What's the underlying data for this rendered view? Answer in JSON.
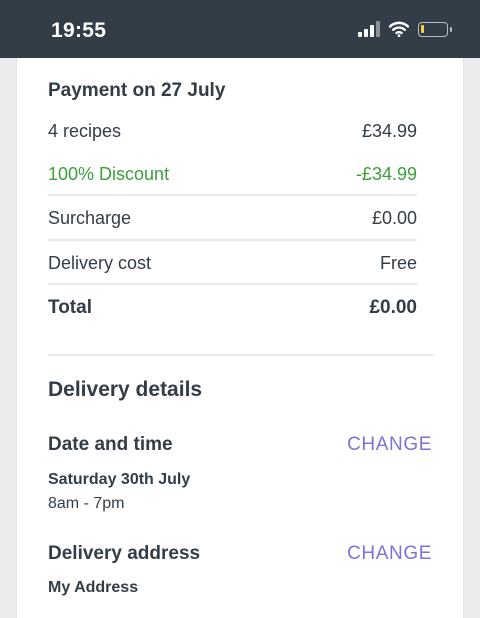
{
  "status_bar": {
    "time": "19:55",
    "icons": [
      "signal-icon",
      "wifi-icon",
      "battery-icon"
    ],
    "battery_fill_fraction": 0.12
  },
  "payment": {
    "title": "Payment on 27 July",
    "rows": [
      {
        "label": "4 recipes",
        "value": "£34.99"
      },
      {
        "label": "100% Discount",
        "value": "-£34.99"
      },
      {
        "label": "Surcharge",
        "value": "£0.00"
      },
      {
        "label": "Delivery cost",
        "value": "Free"
      }
    ],
    "total": {
      "label": "Total",
      "value": "£0.00"
    }
  },
  "delivery": {
    "title": "Delivery details",
    "date_time": {
      "heading": "Date and time",
      "change_label": "CHANGE",
      "date": "Saturday 30th July",
      "time_window": "8am - 7pm"
    },
    "address": {
      "heading": "Delivery address",
      "change_label": "CHANGE",
      "name": "My Address"
    }
  },
  "colors": {
    "status_bar_bg": "#333d47",
    "discount_green": "#3a9f3a",
    "link_purple": "#7b74d6",
    "battery_yellow": "#f7d04a"
  }
}
